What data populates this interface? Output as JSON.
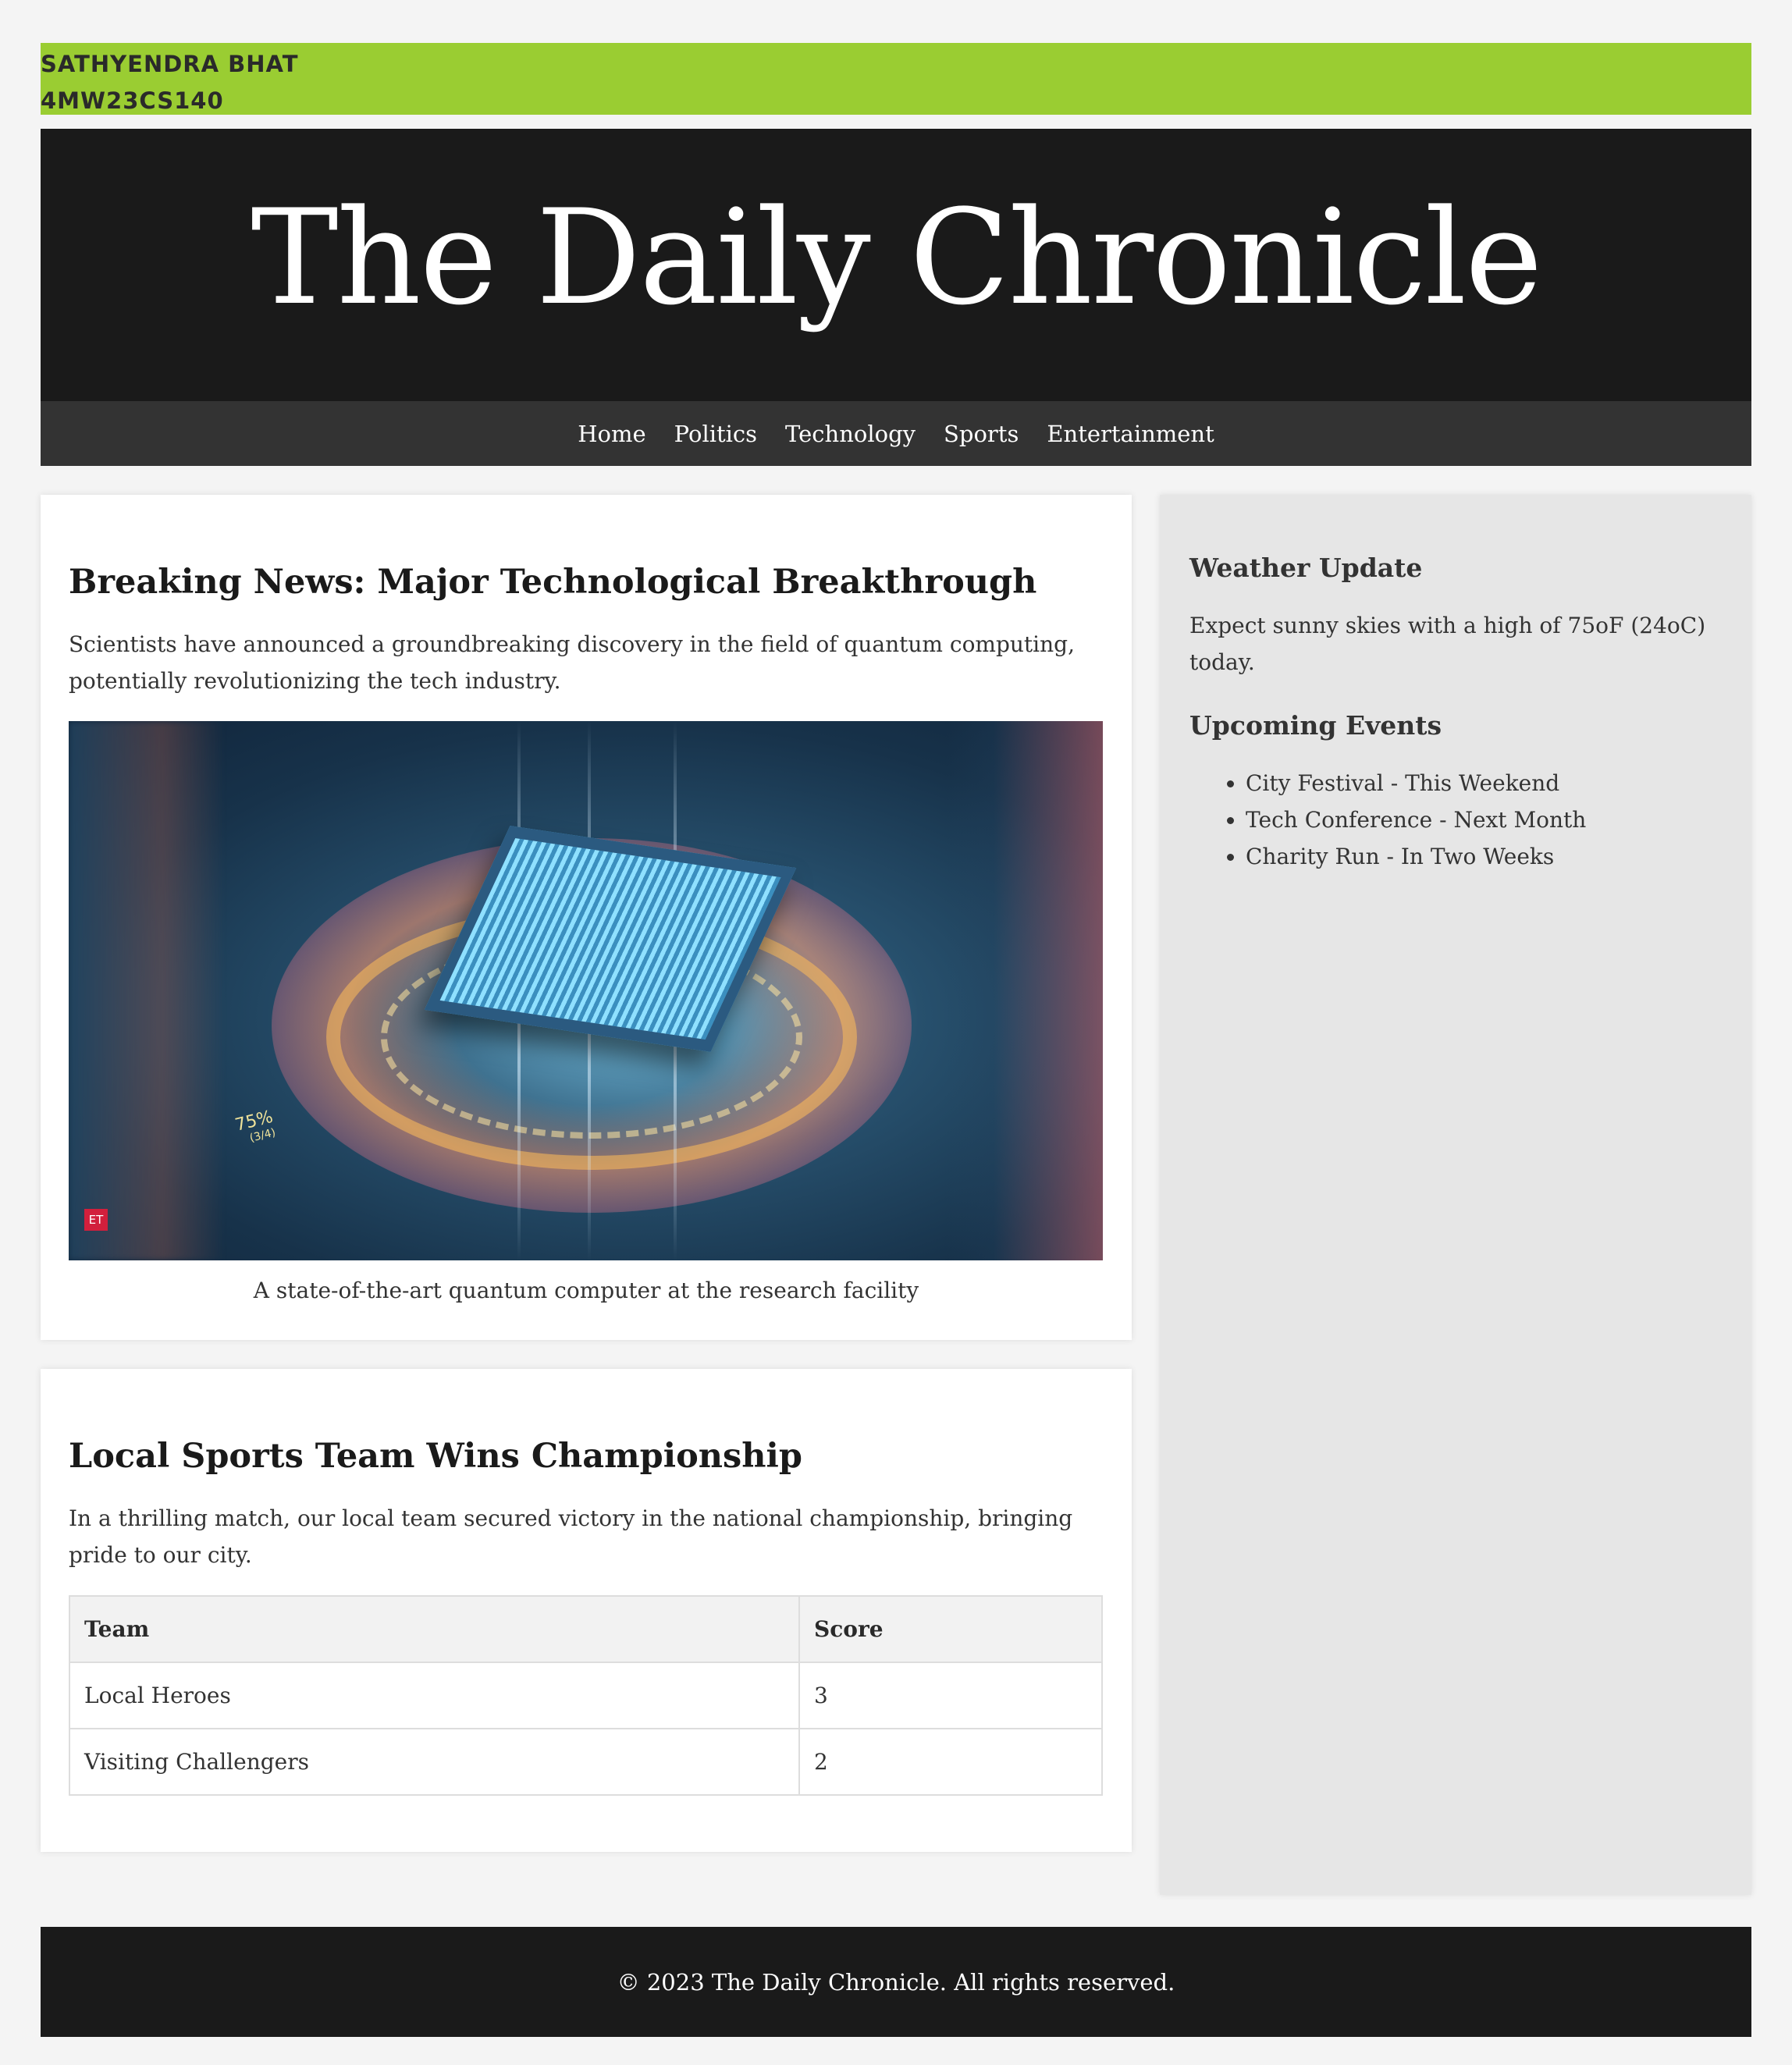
{
  "student": {
    "name": "SATHYENDRA BHAT",
    "id": "4MW23CS140"
  },
  "site": {
    "title": "The Daily Chronicle"
  },
  "nav": {
    "items": [
      "Home",
      "Politics",
      "Technology",
      "Sports",
      "Entertainment"
    ]
  },
  "articles": [
    {
      "headline": "Breaking News: Major Technological Breakthrough",
      "body": "Scientists have announced a groundbreaking discovery in the field of quantum computing, potentially revolutionizing the tech industry.",
      "image": {
        "overlay_percent": "75%",
        "overlay_sub": "(3/4)",
        "badge": "ET"
      },
      "caption": "A state-of-the-art quantum computer at the research facility"
    },
    {
      "headline": "Local Sports Team Wins Championship",
      "body": "In a thrilling match, our local team secured victory in the national championship, bringing pride to our city.",
      "table": {
        "headers": [
          "Team",
          "Score"
        ],
        "rows": [
          [
            "Local Heroes",
            "3"
          ],
          [
            "Visiting Challengers",
            "2"
          ]
        ]
      }
    }
  ],
  "sidebar": {
    "weather_heading": "Weather Update",
    "weather_text": "Expect sunny skies with a high of 75oF (24oC) today.",
    "events_heading": "Upcoming Events",
    "events": [
      "City Festival - This Weekend",
      "Tech Conference - Next Month",
      "Charity Run - In Two Weeks"
    ]
  },
  "footer": {
    "text": "© 2023 The Daily Chronicle. All rights reserved."
  },
  "colors": {
    "banner": "#9acd32",
    "masthead": "#1a1a1a",
    "nav": "#333333",
    "page_bg": "#f4f4f4",
    "sidebar_bg": "#e6e6e6"
  }
}
